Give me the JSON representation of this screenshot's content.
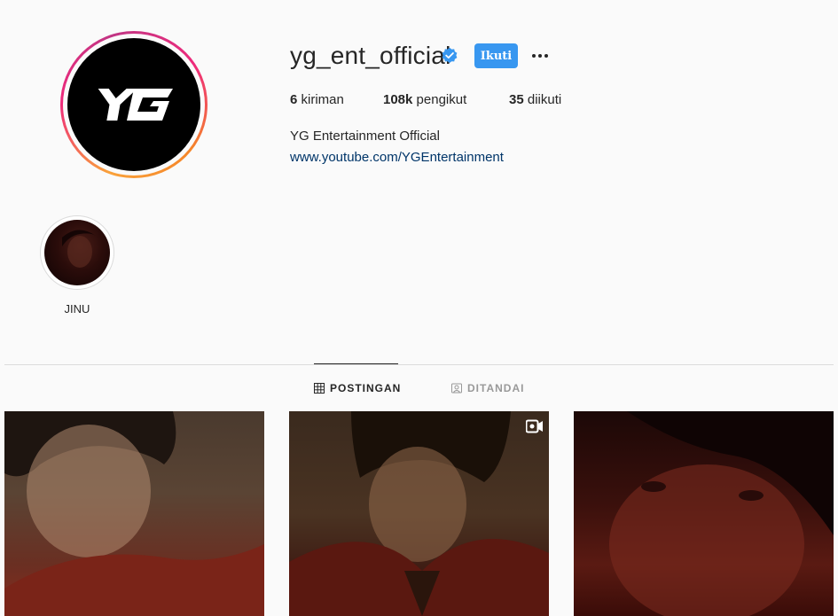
{
  "profile": {
    "username": "yg_ent_official",
    "verified_icon": "verified-badge-icon",
    "follow_label": "Ikuti",
    "full_name": "YG Entertainment Official",
    "link": "www.youtube.com/YGEntertainment",
    "stats": {
      "posts_count": "6",
      "posts_label": "kiriman",
      "followers_count": "108k",
      "followers_label": "pengikut",
      "following_count": "35",
      "following_label": "diikuti"
    }
  },
  "highlights": [
    {
      "label": "JINU"
    }
  ],
  "tabs": [
    {
      "label": "POSTINGAN",
      "icon": "grid-icon",
      "active": true
    },
    {
      "label": "DITANDAI",
      "icon": "tagged-icon",
      "active": false
    }
  ],
  "posts": [
    {
      "type": "image"
    },
    {
      "type": "video",
      "icon": "video-icon"
    },
    {
      "type": "image"
    }
  ],
  "colors": {
    "follow_button": "#3897f0",
    "verified": "#3897f0",
    "link": "#003569"
  }
}
